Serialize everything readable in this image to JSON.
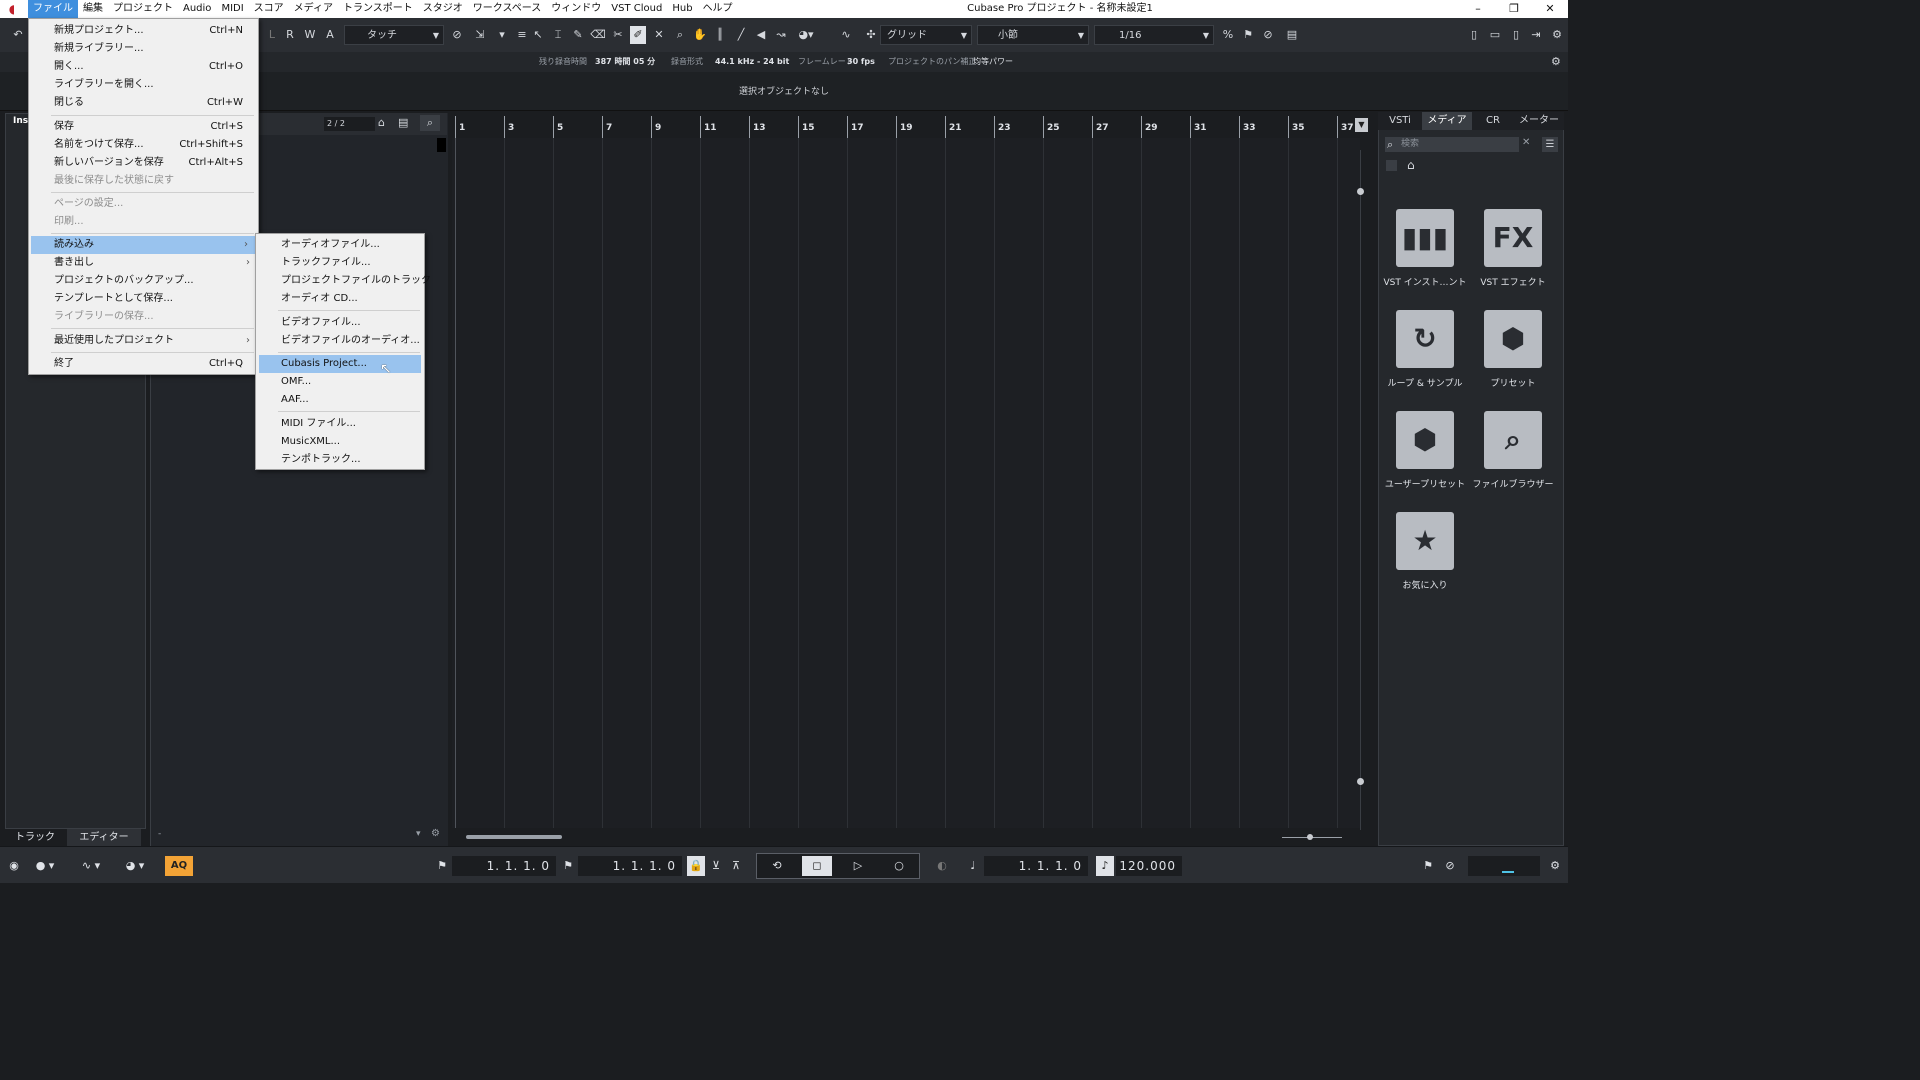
{
  "menubar": {
    "app_icon": "cubase-logo-icon",
    "items": [
      "ファイル",
      "編集",
      "プロジェクト",
      "Audio",
      "MIDI",
      "スコア",
      "メディア",
      "トランスポート",
      "スタジオ",
      "ワークスペース",
      "ウィンドウ",
      "VST Cloud",
      "Hub",
      "ヘルプ"
    ],
    "title": "Cubase Pro プロジェクト - 名称未設定1",
    "win_buttons": [
      "–",
      "❐",
      "✕"
    ]
  },
  "toolbar": {
    "automation_mode": "タッチ",
    "snap_type": "グリッド",
    "grid_type": "小節",
    "quantize": "1/16",
    "rwa": [
      "L",
      "R",
      "W",
      "A"
    ]
  },
  "status": {
    "rec_time_label": "残り録音時間",
    "rec_time_value": "387 時間 05 分",
    "rec_format_label": "録音形式",
    "rec_format_value": "44.1 kHz - 24 bit",
    "frame_rate_label": "フレームレート",
    "frame_rate_value": "30 fps",
    "pan_label": "プロジェクトのパン補正",
    "pan_value": "均等パワー"
  },
  "info_line": "選択オブジェクトなし",
  "inspector": {
    "label": "Ins",
    "tabs": [
      "トラック",
      "エディター"
    ]
  },
  "tracklist": {
    "counter": "2 / 2"
  },
  "ruler": [
    "1",
    "3",
    "5",
    "7",
    "9",
    "11",
    "13",
    "15",
    "17",
    "19",
    "21",
    "23",
    "25",
    "27",
    "29",
    "31",
    "33",
    "35",
    "37"
  ],
  "rightzone": {
    "tabs": [
      "VSTi",
      "メディア",
      "CR",
      "メーター"
    ],
    "search_placeholder": "検索",
    "tiles": [
      {
        "icon": "piano-keys-icon",
        "glyph": "▮▮▮",
        "caption": "VST インスト…ント"
      },
      {
        "icon": "fx-icon",
        "glyph": "FX",
        "caption": "VST エフェクト"
      },
      {
        "icon": "loop-icon",
        "glyph": "↻",
        "caption": "ループ & サンプル"
      },
      {
        "icon": "preset-icon",
        "glyph": "⬢",
        "caption": "プリセット"
      },
      {
        "icon": "user-preset-icon",
        "glyph": "⬢",
        "caption": "ユーザープリセット"
      },
      {
        "icon": "file-browser-icon",
        "glyph": "⌕",
        "caption": "ファイルブラウザー"
      },
      {
        "icon": "favorites-icon",
        "glyph": "★",
        "caption": "お気に入り"
      }
    ]
  },
  "transport": {
    "left_locator": "1. 1. 1.  0",
    "right_locator": "1. 1. 1.  0",
    "position": "1. 1. 1.  0",
    "tempo": "120.000",
    "aq": "AQ"
  },
  "file_menu": {
    "items": [
      {
        "label": "新規プロジェクト...",
        "shortcut": "Ctrl+N"
      },
      {
        "label": "新規ライブラリー...",
        "shortcut": ""
      },
      {
        "label": "開く...",
        "shortcut": "Ctrl+O"
      },
      {
        "label": "ライブラリーを開く...",
        "shortcut": ""
      },
      {
        "label": "閉じる",
        "shortcut": "Ctrl+W"
      },
      {
        "label": "保存",
        "shortcut": "Ctrl+S"
      },
      {
        "label": "名前をつけて保存...",
        "shortcut": "Ctrl+Shift+S"
      },
      {
        "label": "新しいバージョンを保存",
        "shortcut": "Ctrl+Alt+S"
      },
      {
        "label": "最後に保存した状態に戻す",
        "shortcut": ""
      },
      {
        "label": "ページの設定...",
        "shortcut": ""
      },
      {
        "label": "印刷...",
        "shortcut": ""
      },
      {
        "label": "読み込み",
        "shortcut": ""
      },
      {
        "label": "書き出し",
        "shortcut": ""
      },
      {
        "label": "プロジェクトのバックアップ...",
        "shortcut": ""
      },
      {
        "label": "テンプレートとして保存...",
        "shortcut": ""
      },
      {
        "label": "ライブラリーの保存...",
        "shortcut": ""
      },
      {
        "label": "最近使用したプロジェクト",
        "shortcut": ""
      },
      {
        "label": "終了",
        "shortcut": "Ctrl+Q"
      }
    ]
  },
  "import_submenu": {
    "items": [
      "オーディオファイル...",
      "トラックファイル...",
      "プロジェクトファイルのトラック",
      "オーディオ CD...",
      "ビデオファイル...",
      "ビデオファイルのオーディオ...",
      "Cubasis Project...",
      "OMF...",
      "AAF...",
      "MIDI ファイル...",
      "MusicXML...",
      "テンポトラック..."
    ]
  }
}
